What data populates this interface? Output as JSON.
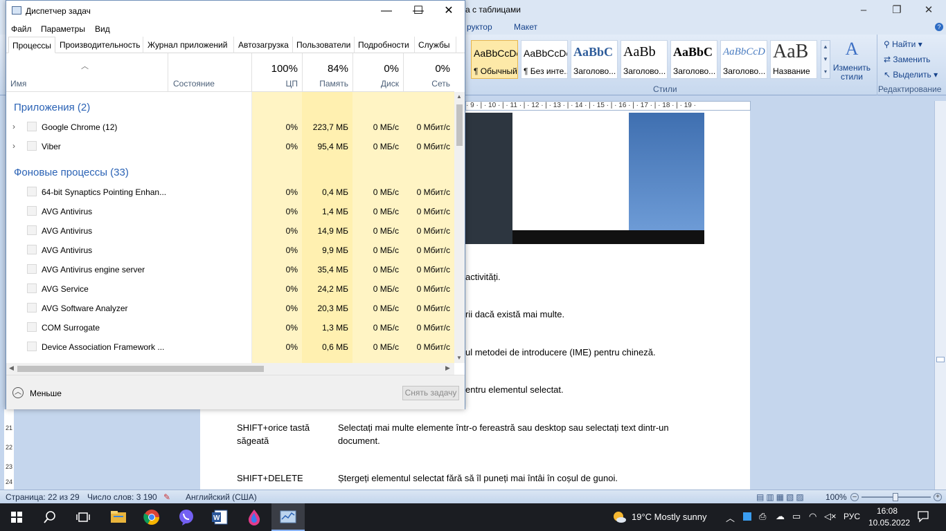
{
  "word": {
    "title": "а с таблицами",
    "window_controls": {
      "minimize": "–",
      "restore": "❐",
      "close": "✕"
    },
    "tabs": [
      "руктор",
      "Макет"
    ],
    "styles": [
      {
        "sample": "AaBbCcDc",
        "name": "¶ Обычный",
        "selected": true
      },
      {
        "sample": "AaBbCcDc",
        "name": "¶ Без инте...",
        "selected": false
      },
      {
        "sample": "AaBbC",
        "name": "Заголово...",
        "selected": false
      },
      {
        "sample": "AaBb",
        "name": "Заголово...",
        "selected": false
      },
      {
        "sample": "AaBbC",
        "name": "Заголово...",
        "selected": false
      },
      {
        "sample": "AaBbCcD",
        "name": "Заголово...",
        "selected": false
      },
      {
        "sample": "AaB",
        "name": "Название",
        "selected": false
      }
    ],
    "change_styles": "Изменить стили",
    "styles_group": "Стили",
    "editing": {
      "find": "Найти",
      "replace": "Заменить",
      "select": "Выделить",
      "group": "Редактирование"
    },
    "ruler": "· 9 · | · 10 · | · 11 · | · 12 · | · 13 · | · 14 · | · 15 · | · 16 · | · 17 · | · 18 · | · 19 ·",
    "doc": {
      "line1": "activități.",
      "line2": "rii dacă există mai multe.",
      "line3": "ul metodei de introducere (IME) pentru chineză.",
      "line4": "entru elementul selectat.",
      "key5": "SHIFT+orice tastă",
      "key5b": "săgeată",
      "desc5": "Selectați mai multe elemente într-o fereastră sau desktop sau selectați text dintr-un",
      "desc5b": "document.",
      "key6": "SHIFT+DELETE",
      "desc6": "Ștergeți elementul selectat fără să îl puneți mai întâi în coșul de gunoi."
    },
    "status": {
      "page": "Страница: 22 из 29",
      "words": "Число слов: 3 190",
      "language": "Английский (США)",
      "zoom": "100%"
    },
    "left_ruler": [
      "21",
      "22",
      "23",
      "24"
    ]
  },
  "taskmanager": {
    "title": "Диспетчер задач",
    "window_controls": {
      "minimize": "—",
      "maximize": "☐",
      "close": "✕"
    },
    "menu": [
      "Файл",
      "Параметры",
      "Вид"
    ],
    "tabs": [
      "Процессы",
      "Производительность",
      "Журнал приложений",
      "Автозагрузка",
      "Пользователи",
      "Подробности",
      "Службы"
    ],
    "columns": {
      "name": "Имя",
      "status": "Состояние",
      "cpu": {
        "pct": "100%",
        "label": "ЦП"
      },
      "mem": {
        "pct": "84%",
        "label": "Память"
      },
      "disk": {
        "pct": "0%",
        "label": "Диск"
      },
      "net": {
        "pct": "0%",
        "label": "Сеть"
      }
    },
    "groups": {
      "apps": "Приложения (2)",
      "background": "Фоновые процессы (33)"
    },
    "apps": [
      {
        "name": "Google Chrome (12)",
        "cpu": "0%",
        "mem": "223,7 МБ",
        "disk": "0 МБ/с",
        "net": "0 Мбит/с"
      },
      {
        "name": "Viber",
        "cpu": "0%",
        "mem": "95,4 МБ",
        "disk": "0 МБ/с",
        "net": "0 Мбит/с"
      }
    ],
    "background": [
      {
        "name": "64-bit Synaptics Pointing Enhan...",
        "cpu": "0%",
        "mem": "0,4 МБ",
        "disk": "0 МБ/с",
        "net": "0 Мбит/с"
      },
      {
        "name": "AVG Antivirus",
        "cpu": "0%",
        "mem": "1,4 МБ",
        "disk": "0 МБ/с",
        "net": "0 Мбит/с"
      },
      {
        "name": "AVG Antivirus",
        "cpu": "0%",
        "mem": "14,9 МБ",
        "disk": "0 МБ/с",
        "net": "0 Мбит/с"
      },
      {
        "name": "AVG Antivirus",
        "cpu": "0%",
        "mem": "9,9 МБ",
        "disk": "0 МБ/с",
        "net": "0 Мбит/с"
      },
      {
        "name": "AVG Antivirus engine server",
        "cpu": "0%",
        "mem": "35,4 МБ",
        "disk": "0 МБ/с",
        "net": "0 Мбит/с"
      },
      {
        "name": "AVG Service",
        "cpu": "0%",
        "mem": "24,2 МБ",
        "disk": "0 МБ/с",
        "net": "0 Мбит/с"
      },
      {
        "name": "AVG Software Analyzer",
        "cpu": "0%",
        "mem": "20,3 МБ",
        "disk": "0 МБ/с",
        "net": "0 Мбит/с"
      },
      {
        "name": "COM Surrogate",
        "cpu": "0%",
        "mem": "1,3 МБ",
        "disk": "0 МБ/с",
        "net": "0 Мбит/с"
      },
      {
        "name": "Device Association Framework ...",
        "cpu": "0%",
        "mem": "0,6 МБ",
        "disk": "0 МБ/с",
        "net": "0 Мбит/с"
      }
    ],
    "fewer_label": "Меньше",
    "end_task": "Снять задачу"
  },
  "taskbar": {
    "weather": "19°C  Mostly sunny",
    "lang": "РУС",
    "time": "16:08",
    "date": "10.05.2022"
  }
}
